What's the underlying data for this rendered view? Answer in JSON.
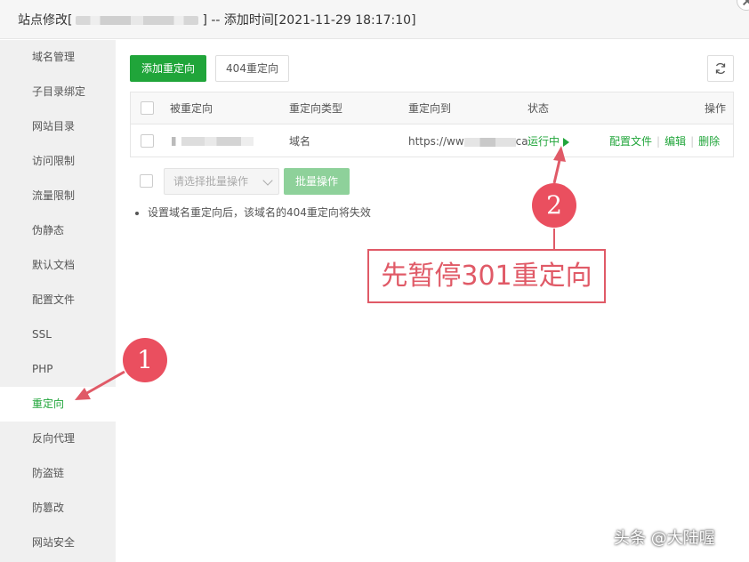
{
  "window": {
    "title_prefix": "站点修改[",
    "title_suffix": "] -- 添加时间[2021-11-29 18:17:10]"
  },
  "sidebar": {
    "items": [
      {
        "label": "域名管理"
      },
      {
        "label": "子目录绑定"
      },
      {
        "label": "网站目录"
      },
      {
        "label": "访问限制"
      },
      {
        "label": "流量限制"
      },
      {
        "label": "伪静态"
      },
      {
        "label": "默认文档"
      },
      {
        "label": "配置文件"
      },
      {
        "label": "SSL"
      },
      {
        "label": "PHP"
      },
      {
        "label": "重定向",
        "active": true
      },
      {
        "label": "反向代理"
      },
      {
        "label": "防盗链"
      },
      {
        "label": "防篡改"
      },
      {
        "label": "网站安全"
      }
    ]
  },
  "toolbar": {
    "add_label": "添加重定向",
    "redirect404_label": "404重定向"
  },
  "table": {
    "headers": [
      "被重定向",
      "重定向类型",
      "重定向到",
      "状态",
      "操作"
    ],
    "rows": [
      {
        "source": "",
        "type": "域名",
        "target_prefix": "https://ww",
        "target_suffix": "ca",
        "status": "运行中",
        "actions": [
          "配置文件",
          "编辑",
          "删除"
        ]
      }
    ]
  },
  "batch": {
    "select_placeholder": "请选择批量操作",
    "button_label": "批量操作"
  },
  "note": "设置域名重定向后，该域名的404重定向将失效",
  "annotations": {
    "badge1": "1",
    "badge2": "2",
    "callout": "先暂停301重定向",
    "color": "#e05a67"
  },
  "watermark": "头条 @大陆喔",
  "colors": {
    "accent": "#20a53a",
    "sidebar_bg": "#f0f0f0"
  }
}
